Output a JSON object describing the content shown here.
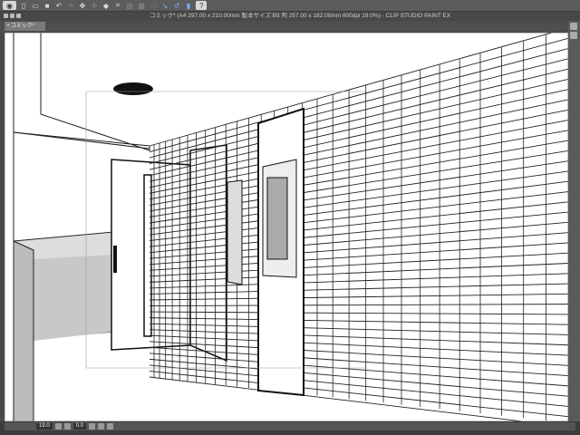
{
  "toolbar": {
    "icons": [
      "eye-icon",
      "new-file-icon",
      "open-icon",
      "save-icon",
      "undo-icon",
      "redo-icon",
      "transform-icon",
      "fill-icon",
      "fit-icon",
      "ruler-snap-icon",
      "help-icon"
    ],
    "help_label": "?"
  },
  "window": {
    "title": "コミック* (A4 297.00 x 210.00mm 製本サイズ:B5 判 257.00 x 182.00mm 600dpi 19.0%) - CLIP STUDIO PAINT EX"
  },
  "tabs": [
    {
      "label": "コミック*",
      "active": true
    }
  ],
  "status": {
    "zoom": "19.0",
    "rotation": "0.0"
  }
}
